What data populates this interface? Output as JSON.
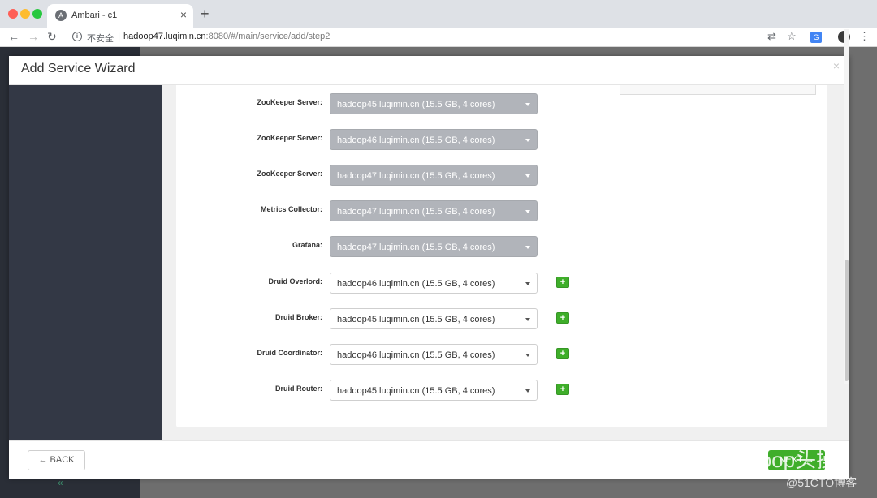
{
  "browser": {
    "tab_title": "Ambari - c1",
    "tab_favicon": "A",
    "tab_close": "×",
    "new_tab": "+",
    "security_label": "不安全",
    "url_host": "hadoop47.luqimin.cn",
    "url_path": ":8080/#/main/service/add/step2"
  },
  "modal": {
    "title": "Add Service Wizard",
    "close": "×"
  },
  "assignments": [
    {
      "label": "ZooKeeper Server:",
      "value": "hadoop45.luqimin.cn (15.5 GB, 4 cores)",
      "editable": false
    },
    {
      "label": "ZooKeeper Server:",
      "value": "hadoop46.luqimin.cn (15.5 GB, 4 cores)",
      "editable": false
    },
    {
      "label": "ZooKeeper Server:",
      "value": "hadoop47.luqimin.cn (15.5 GB, 4 cores)",
      "editable": false
    },
    {
      "label": "Metrics Collector:",
      "value": "hadoop47.luqimin.cn (15.5 GB, 4 cores)",
      "editable": false
    },
    {
      "label": "Grafana:",
      "value": "hadoop47.luqimin.cn (15.5 GB, 4 cores)",
      "editable": false
    },
    {
      "label": "Druid Overlord:",
      "value": "hadoop46.luqimin.cn (15.5 GB, 4 cores)",
      "editable": true
    },
    {
      "label": "Druid Broker:",
      "value": "hadoop45.luqimin.cn (15.5 GB, 4 cores)",
      "editable": true
    },
    {
      "label": "Druid Coordinator:",
      "value": "hadoop46.luqimin.cn (15.5 GB, 4 cores)",
      "editable": true
    },
    {
      "label": "Druid Router:",
      "value": "hadoop45.luqimin.cn (15.5 GB, 4 cores)",
      "editable": true
    }
  ],
  "add_button_label": "+",
  "footer": {
    "back_label": "← BACK",
    "next_label": "NEXT →"
  },
  "watermark": {
    "title": "Hadoop头操",
    "sub": "@51CTO博客"
  },
  "backdrop": {
    "chevron": "«"
  },
  "colors": {
    "primary_green": "#3fae2a",
    "sidebar_dark": "#333845",
    "disabled_select": "#b1b4ba"
  }
}
